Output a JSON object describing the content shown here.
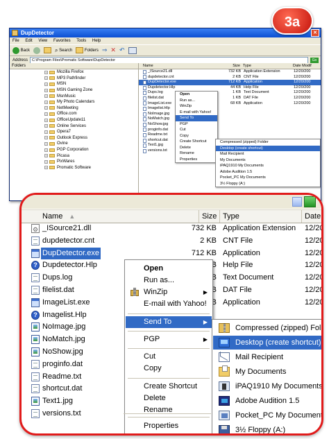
{
  "badge": "3a",
  "window": {
    "title": "DupDetector",
    "menu": [
      "File",
      "Edit",
      "View",
      "Favorites",
      "Tools",
      "Help"
    ],
    "toolbar": {
      "back": "Back",
      "search": "Search",
      "folders": "Folders"
    },
    "address_label": "Address",
    "address_value": "C:\\Program Files\\Promatic Software\\DupDetector",
    "go_label": "Go",
    "folders_header": "Folders",
    "folders": [
      "Mozilla Firefox",
      "MP3 Pathfinder",
      "MSN",
      "MSN Gaming Zone",
      "MsnMusic",
      "My Photo Calendars",
      "NetMeeting",
      "Office.com",
      "OfficeUpdate11",
      "Online Services",
      "Opera7",
      "Outlook Express",
      "Ovine",
      "PGP Corporation",
      "Picasa",
      "PixWares",
      "Promatic Software"
    ],
    "columns": {
      "name": "Name",
      "size": "Size",
      "type": "Type",
      "date": "Date Modif"
    },
    "files": [
      {
        "name": "_ISource21.dll",
        "size": "732 KB",
        "type": "Application Extension",
        "date": "12/20/200"
      },
      {
        "name": "dupdetector.cnt",
        "size": "2 KB",
        "type": "CNT File",
        "date": "12/20/200"
      },
      {
        "name": "DupDetector.exe",
        "size": "712 KB",
        "type": "Application",
        "date": "12/20/200"
      },
      {
        "name": "Dupdetector.Hlp",
        "size": "44 KB",
        "type": "Help File",
        "date": "12/20/200"
      },
      {
        "name": "Dups.log",
        "size": "1 KB",
        "type": "Text Document",
        "date": "12/20/200"
      },
      {
        "name": "filelist.dat",
        "size": "1 KB",
        "type": "DAT File",
        "date": "12/20/200"
      },
      {
        "name": "ImageList.exe",
        "size": "68 KB",
        "type": "Application",
        "date": "12/20/200"
      },
      {
        "name": "Imagelist.Hlp",
        "size": "",
        "type": "",
        "date": ""
      },
      {
        "name": "NoImage.jpg",
        "size": "",
        "type": "",
        "date": ""
      },
      {
        "name": "NoMatch.jpg",
        "size": "",
        "type": "",
        "date": ""
      },
      {
        "name": "NoShow.jpg",
        "size": "",
        "type": "",
        "date": ""
      },
      {
        "name": "proginfo.dat",
        "size": "",
        "type": "",
        "date": ""
      },
      {
        "name": "Readme.txt",
        "size": "",
        "type": "",
        "date": ""
      },
      {
        "name": "shortcut.dat",
        "size": "",
        "type": "",
        "date": ""
      },
      {
        "name": "Text1.jpg",
        "size": "",
        "type": "",
        "date": ""
      },
      {
        "name": "versions.txt",
        "size": "",
        "type": "",
        "date": ""
      }
    ],
    "context_menu": [
      "Open",
      "Run as...",
      "WinZip",
      "E-mail with Yahoo!",
      "Send To",
      "PGP",
      "Cut",
      "Copy",
      "Create Shortcut",
      "Delete",
      "Rename",
      "Properties"
    ],
    "send_to": [
      "Compressed (zipped) Folder",
      "Desktop (create shortcut)",
      "Mail Recipient",
      "My Documents",
      "iPAQ1910 My Documents",
      "Adobe Audition 1.5",
      "Pocket_PC My Documents",
      "3½ Floppy (A:)"
    ]
  },
  "zoom": {
    "columns": {
      "name": "Name",
      "size": "Size",
      "type": "Type",
      "date": "Date"
    },
    "files": [
      {
        "name": "_ISource21.dll",
        "size": "732 KB",
        "type": "Application Extension",
        "date": "12/20",
        "icon": "dll"
      },
      {
        "name": "dupdetector.cnt",
        "size": "2 KB",
        "type": "CNT File",
        "date": "12/20",
        "icon": "doc"
      },
      {
        "name": "DupDetector.exe",
        "size": "712 KB",
        "type": "Application",
        "date": "12/20",
        "icon": "app",
        "selected": true
      },
      {
        "name": "Dupdetector.Hlp",
        "size": "44 KB",
        "type": "Help File",
        "date": "12/20",
        "icon": "help"
      },
      {
        "name": "Dups.log",
        "size": "1 KB",
        "type": "Text Document",
        "date": "12/20",
        "icon": "doc"
      },
      {
        "name": "filelist.dat",
        "size": "1 KB",
        "type": "DAT File",
        "date": "12/20",
        "icon": "doc"
      },
      {
        "name": "ImageList.exe",
        "size": "68 KB",
        "type": "Application",
        "date": "12/20",
        "icon": "app"
      },
      {
        "name": "Imagelist.Hlp",
        "size": "",
        "type": "",
        "date": "",
        "icon": "help"
      },
      {
        "name": "NoImage.jpg",
        "size": "",
        "type": "",
        "date": "",
        "icon": "img"
      },
      {
        "name": "NoMatch.jpg",
        "size": "",
        "type": "",
        "date": "",
        "icon": "img"
      },
      {
        "name": "NoShow.jpg",
        "size": "",
        "type": "",
        "date": "",
        "icon": "img"
      },
      {
        "name": "proginfo.dat",
        "size": "",
        "type": "",
        "date": "",
        "icon": "doc"
      },
      {
        "name": "Readme.txt",
        "size": "",
        "type": "",
        "date": "",
        "icon": "doc"
      },
      {
        "name": "shortcut.dat",
        "size": "",
        "type": "",
        "date": "",
        "icon": "doc"
      },
      {
        "name": "Text1.jpg",
        "size": "",
        "type": "",
        "date": "",
        "icon": "img"
      },
      {
        "name": "versions.txt",
        "size": "",
        "type": "",
        "date": "",
        "icon": "doc"
      }
    ],
    "context_menu": {
      "open": "Open",
      "run_as": "Run as...",
      "winzip": "WinZip",
      "email": "E-mail with Yahoo!",
      "send_to": "Send To",
      "pgp": "PGP",
      "cut": "Cut",
      "copy": "Copy",
      "create_shortcut": "Create Shortcut",
      "delete": "Delete",
      "rename": "Rename",
      "properties": "Properties"
    },
    "send_to": [
      {
        "label": "Compressed (zipped) Folder",
        "icon": "zipfold"
      },
      {
        "label": "Desktop (create shortcut)",
        "icon": "desk",
        "highlighted": true
      },
      {
        "label": "Mail Recipient",
        "icon": "mail"
      },
      {
        "label": "My Documents",
        "icon": "mydocs"
      },
      {
        "label": "iPAQ1910 My Documents",
        "icon": "ipaq"
      },
      {
        "label": "Adobe Audition 1.5",
        "icon": "adobe"
      },
      {
        "label": "Pocket_PC My Documents",
        "icon": "pocket"
      },
      {
        "label": "3½ Floppy (A:)",
        "icon": "floppy"
      }
    ]
  },
  "colors": {
    "selection": "#316ac5",
    "highlight_frame": "#e11b1b",
    "badge": "#d9231a"
  }
}
